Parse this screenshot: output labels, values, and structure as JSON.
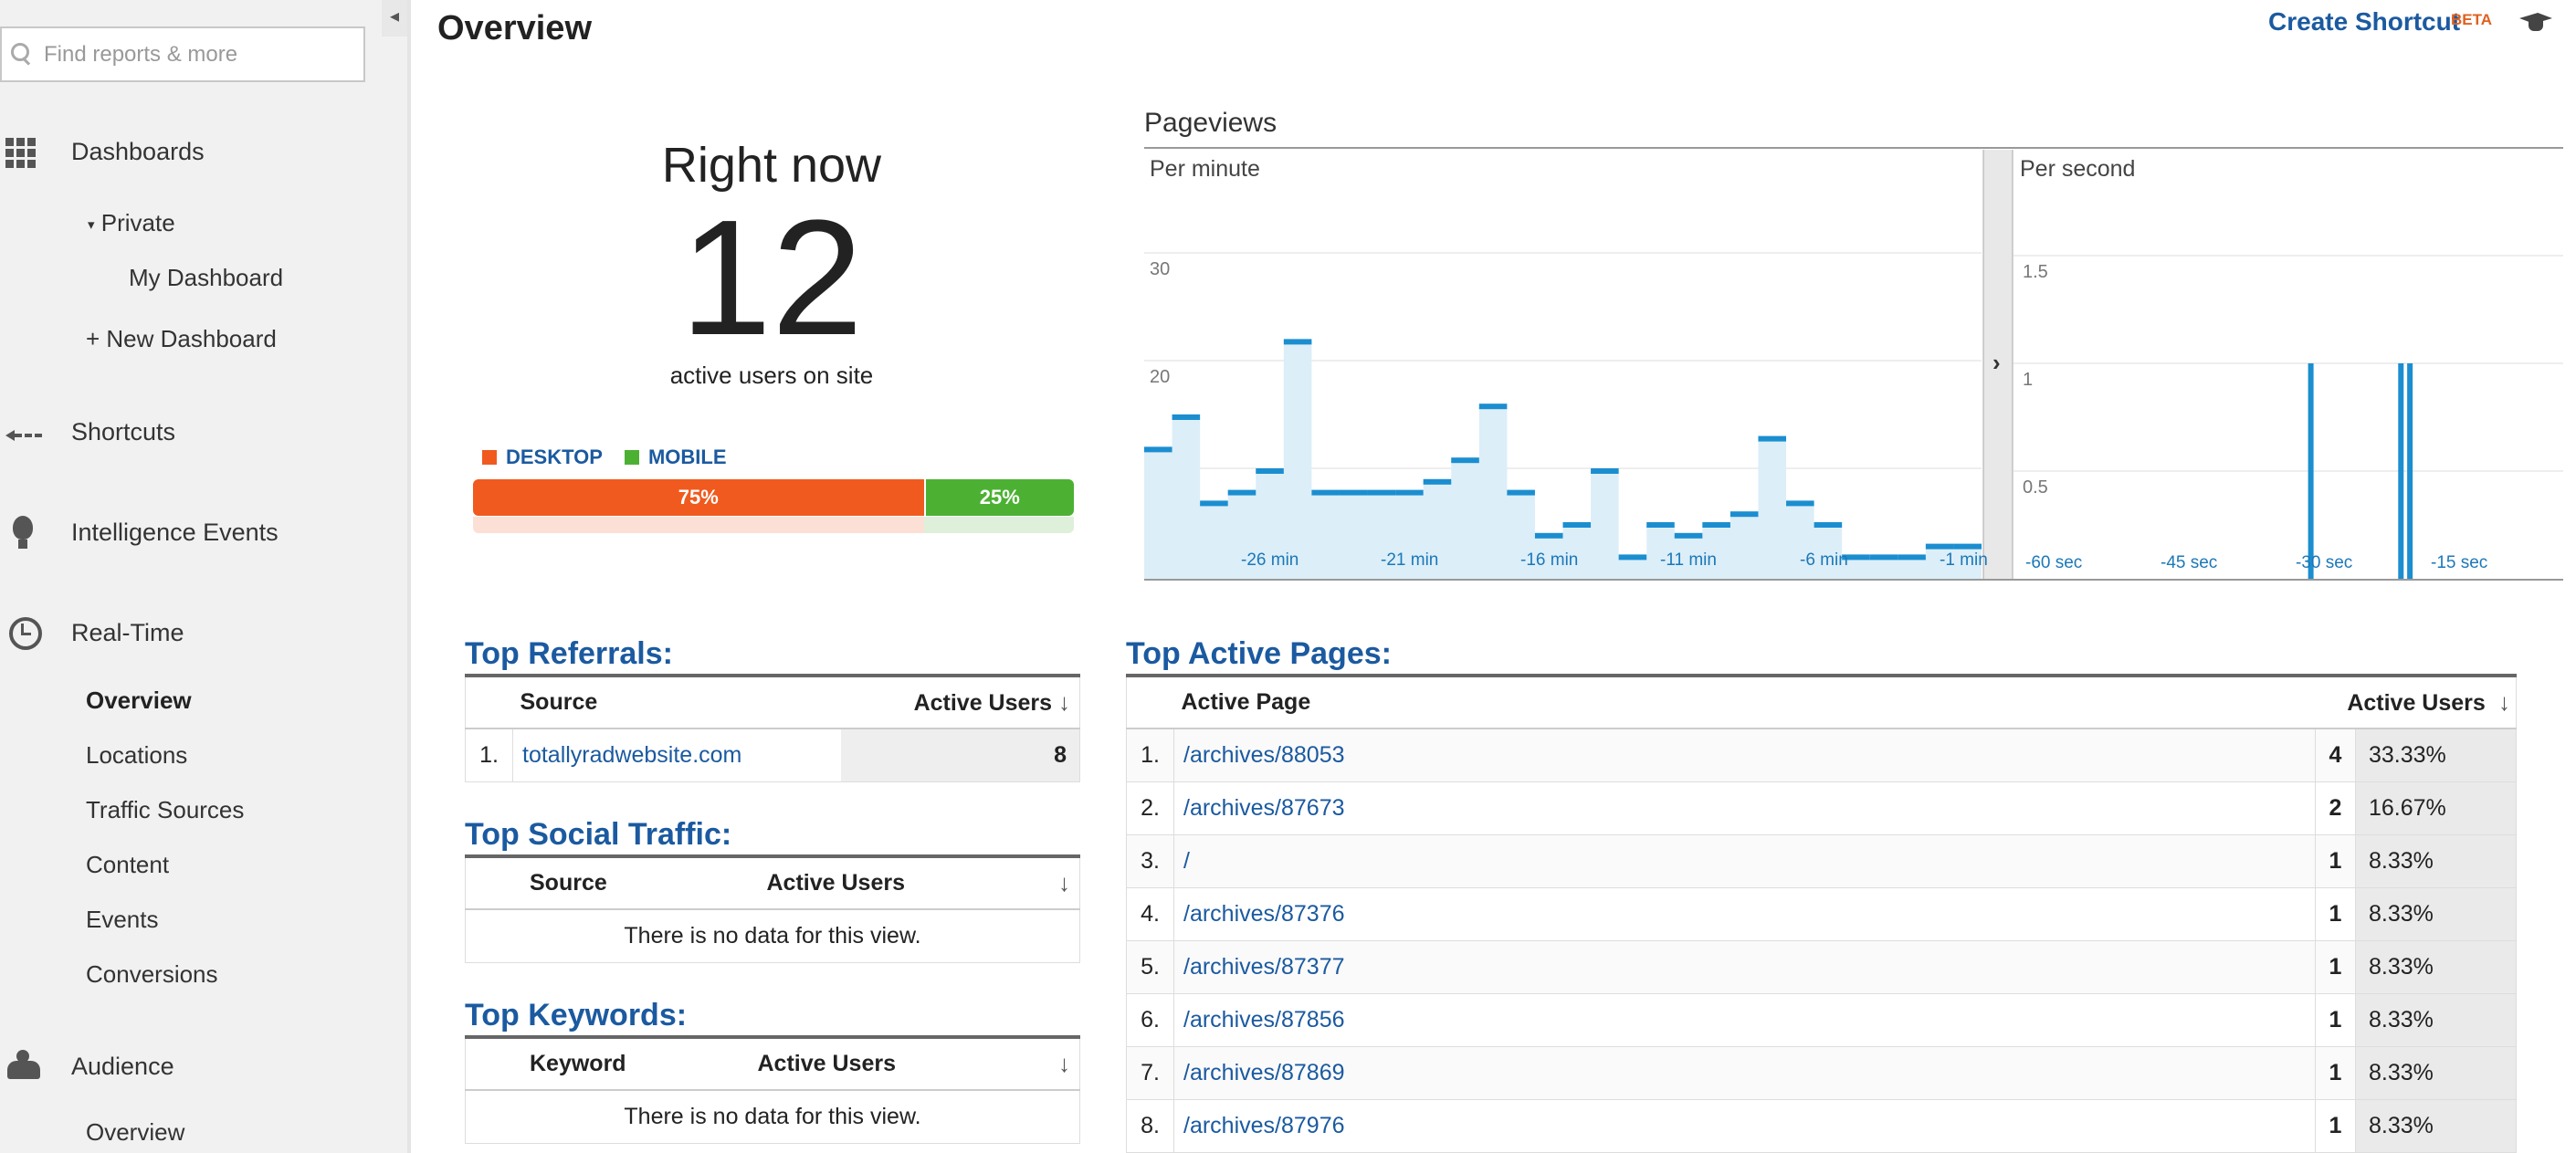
{
  "sidebar": {
    "search_placeholder": "Find reports & more",
    "collapse_glyph": "◂",
    "dashboards": {
      "label": "Dashboards",
      "private": "Private",
      "my_dashboard": "My Dashboard",
      "new_dashboard": "+ New Dashboard"
    },
    "shortcuts": "Shortcuts",
    "intelligence": "Intelligence Events",
    "realtime": {
      "label": "Real-Time",
      "items": [
        "Overview",
        "Locations",
        "Traffic Sources",
        "Content",
        "Events",
        "Conversions"
      ]
    },
    "audience": {
      "label": "Audience",
      "items": [
        "Overview"
      ]
    }
  },
  "header": {
    "title": "Overview",
    "create_shortcut": "Create Shortcut",
    "beta": "BETA"
  },
  "right_now": {
    "label": "Right now",
    "count": "12",
    "sub": "active users on site",
    "legend_desktop": "DESKTOP",
    "legend_mobile": "MOBILE",
    "desktop_pct": "75%",
    "mobile_pct": "25%",
    "desktop_share": 0.75,
    "colors": {
      "desktop": "#f05a1e",
      "mobile": "#4cb133"
    }
  },
  "chart_data": [
    {
      "type": "area",
      "title": "Pageviews",
      "subtitle": "Per minute",
      "ylim": [
        0,
        30
      ],
      "yticks": [
        "30",
        "20",
        "10"
      ],
      "x_tick_labels": [
        "-26 min",
        "-21 min",
        "-16 min",
        "-11 min",
        "-6 min",
        "-1 min"
      ],
      "values": [
        12,
        15,
        7,
        8,
        10,
        22,
        8,
        8,
        8,
        8,
        9,
        11,
        16,
        8,
        4,
        5,
        10,
        2,
        5,
        4,
        5,
        6,
        13,
        7,
        5,
        2,
        2,
        2,
        3,
        3
      ],
      "color": "#1b8ed0"
    },
    {
      "type": "bar",
      "subtitle": "Per second",
      "ylim": [
        0,
        1.5
      ],
      "yticks": [
        "1.5",
        "1",
        "0.5"
      ],
      "x_tick_labels": [
        "-60 sec",
        "-45 sec",
        "-30 sec",
        "-15 sec"
      ],
      "spikes_seconds": [
        -27,
        -17,
        -16
      ],
      "spike_value": 1,
      "color": "#1b8ed0"
    }
  ],
  "referrals": {
    "title": "Top Referrals:",
    "headers": [
      "Source",
      "Active Users"
    ],
    "rows": [
      {
        "idx": "1.",
        "source": "totallyradwebsite.com",
        "users": "8"
      }
    ]
  },
  "social": {
    "title": "Top Social Traffic:",
    "headers": [
      "Source",
      "Active Users"
    ],
    "empty": "There is no data for this view."
  },
  "keywords": {
    "title": "Top Keywords:",
    "headers": [
      "Keyword",
      "Active Users"
    ],
    "empty": "There is no data for this view."
  },
  "pages": {
    "title": "Top Active Pages:",
    "headers": [
      "Active Page",
      "Active Users"
    ],
    "rows": [
      {
        "idx": "1.",
        "page": "/archives/88053",
        "users": "4",
        "pct": "33.33%"
      },
      {
        "idx": "2.",
        "page": "/archives/87673",
        "users": "2",
        "pct": "16.67%"
      },
      {
        "idx": "3.",
        "page": "/",
        "users": "1",
        "pct": "8.33%"
      },
      {
        "idx": "4.",
        "page": "/archives/87376",
        "users": "1",
        "pct": "8.33%"
      },
      {
        "idx": "5.",
        "page": "/archives/87377",
        "users": "1",
        "pct": "8.33%"
      },
      {
        "idx": "6.",
        "page": "/archives/87856",
        "users": "1",
        "pct": "8.33%"
      },
      {
        "idx": "7.",
        "page": "/archives/87869",
        "users": "1",
        "pct": "8.33%"
      },
      {
        "idx": "8.",
        "page": "/archives/87976",
        "users": "1",
        "pct": "8.33%"
      }
    ]
  },
  "icons": {
    "sort": "sort-down-icon",
    "dashboards": "grid-icon",
    "shortcuts": "arrow-left-icon",
    "intelligence": "bulb-icon",
    "realtime": "clock-icon",
    "audience": "people-icon",
    "help": "graduation-cap-icon",
    "chart_expand": "chevron-right-icon"
  }
}
